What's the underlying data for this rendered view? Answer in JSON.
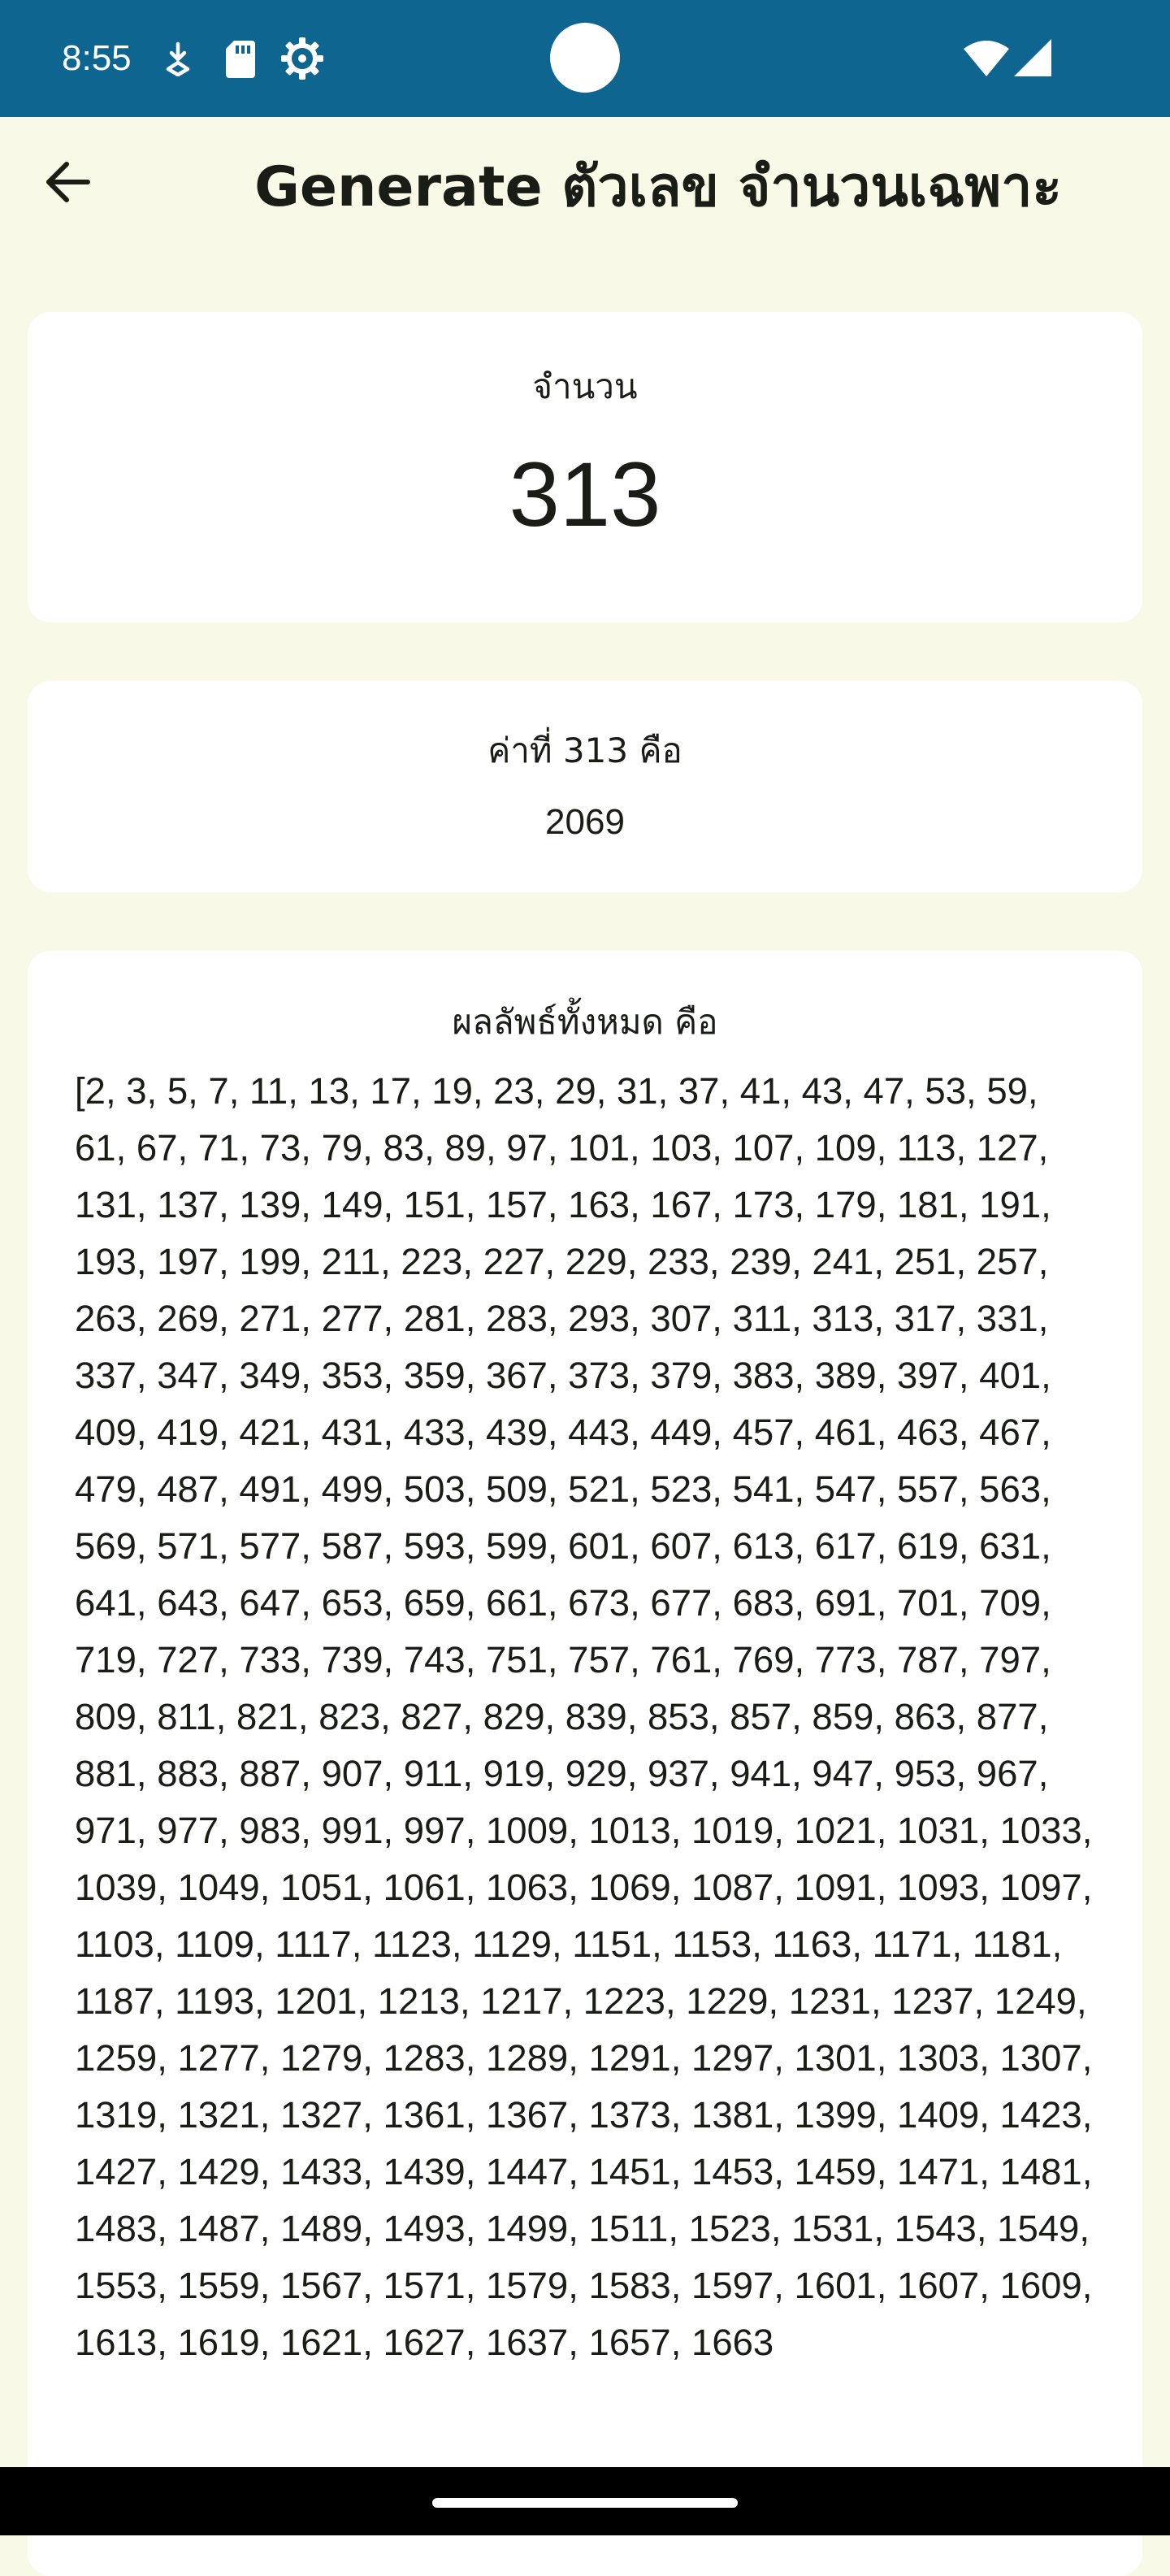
{
  "status_bar": {
    "time": "8:55",
    "background": "#0E6690",
    "icons": [
      "download-badge-icon",
      "sd-card-icon",
      "settings-gear-icon",
      "wifi-icon",
      "cell-signal-icon"
    ]
  },
  "app_bar": {
    "back_icon": "arrow-back-icon",
    "title": "Generate ตัวเลข จำนวนเฉพาะ"
  },
  "count_card": {
    "label": "จำนวน",
    "value": "313"
  },
  "nth_card": {
    "label": "ค่าที่ 313 คือ",
    "value": "2069"
  },
  "all_card": {
    "label": "ผลลัพธ์ทั้งหมด คือ",
    "value": "[2, 3, 5, 7, 11, 13, 17, 19, 23, 29, 31, 37, 41, 43, 47, 53, 59, 61, 67, 71, 73, 79, 83, 89, 97, 101, 103, 107, 109, 113, 127, 131, 137, 139, 149, 151, 157, 163, 167, 173, 179, 181, 191, 193, 197, 199, 211, 223, 227, 229, 233, 239, 241, 251, 257, 263, 269, 271, 277, 281, 283, 293, 307, 311, 313, 317, 331, 337, 347, 349, 353, 359, 367, 373, 379, 383, 389, 397, 401, 409, 419, 421, 431, 433, 439, 443, 449, 457, 461, 463, 467, 479, 487, 491, 499, 503, 509, 521, 523, 541, 547, 557, 563, 569, 571, 577, 587, 593, 599, 601, 607, 613, 617, 619, 631, 641, 643, 647, 653, 659, 661, 673, 677, 683, 691, 701, 709, 719, 727, 733, 739, 743, 751, 757, 761, 769, 773, 787, 797, 809, 811, 821, 823, 827, 829, 839, 853, 857, 859, 863, 877, 881, 883, 887, 907, 911, 919, 929, 937, 941, 947, 953, 967, 971, 977, 983, 991, 997, 1009, 1013, 1019, 1021, 1031, 1033, 1039, 1049, 1051, 1061, 1063, 1069, 1087, 1091, 1093, 1097, 1103, 1109, 1117, 1123, 1129, 1151, 1153, 1163, 1171, 1181, 1187, 1193, 1201, 1213, 1217, 1223, 1229, 1231, 1237, 1249, 1259, 1277, 1279, 1283, 1289, 1291, 1297, 1301, 1303, 1307, 1319, 1321, 1327, 1361, 1367, 1373, 1381, 1399, 1409, 1423, 1427, 1429, 1433, 1439, 1447, 1451, 1453, 1459, 1471, 1481, 1483, 1487, 1489, 1493, 1499, 1511, 1523, 1531, 1543, 1549, 1553, 1559, 1567, 1571, 1579, 1583, 1597, 1601, 1607, 1609, 1613, 1619, 1621, 1627, 1637, 1657, 1663"
  },
  "nav_bar": {
    "handle_icon": "gesture-handle-icon"
  }
}
